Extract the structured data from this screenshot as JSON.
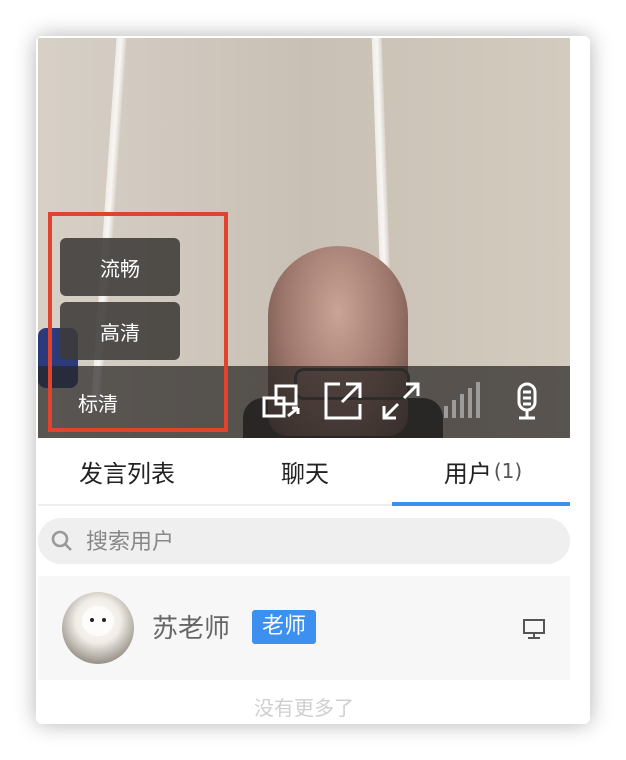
{
  "video": {
    "quality_options": [
      "流畅",
      "高清"
    ],
    "current_quality": "标清",
    "controls": [
      {
        "icon": "switch-camera-icon"
      },
      {
        "icon": "pop-out-icon"
      },
      {
        "icon": "fullscreen-icon"
      },
      {
        "icon": "signal-strength-icon"
      },
      {
        "icon": "microphone-icon"
      }
    ]
  },
  "tabs": [
    {
      "label": "发言列表"
    },
    {
      "label": "聊天"
    },
    {
      "label": "用户",
      "count": "(1)"
    }
  ],
  "active_tab": 2,
  "search": {
    "placeholder": "搜索用户",
    "icon": "search-icon"
  },
  "users": [
    {
      "name": "苏老师",
      "role": "老师",
      "device_icon": "desktop-icon"
    }
  ],
  "list_end_text": "没有更多了",
  "colors": {
    "accent": "#3d8ff0",
    "highlight_border": "#e0442f"
  }
}
